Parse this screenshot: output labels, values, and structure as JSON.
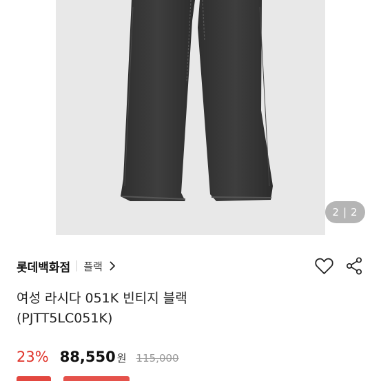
{
  "image_viewer": {
    "current": "2",
    "total": "2"
  },
  "store": {
    "name": "롯데백화점",
    "brand_label": "플랙"
  },
  "product": {
    "title_line1": "여성 라시다 051K 빈티지 블랙",
    "title_line2": "(PJTT5LC051K)"
  },
  "pricing": {
    "discount": "23%",
    "price": "88,550",
    "currency": "원",
    "original_price": "115,000",
    "accent_color": "#e0342b"
  },
  "icons": {
    "brand_chevron": "chevron-right-icon",
    "wishlist": "heart-icon",
    "share": "share-icon"
  }
}
